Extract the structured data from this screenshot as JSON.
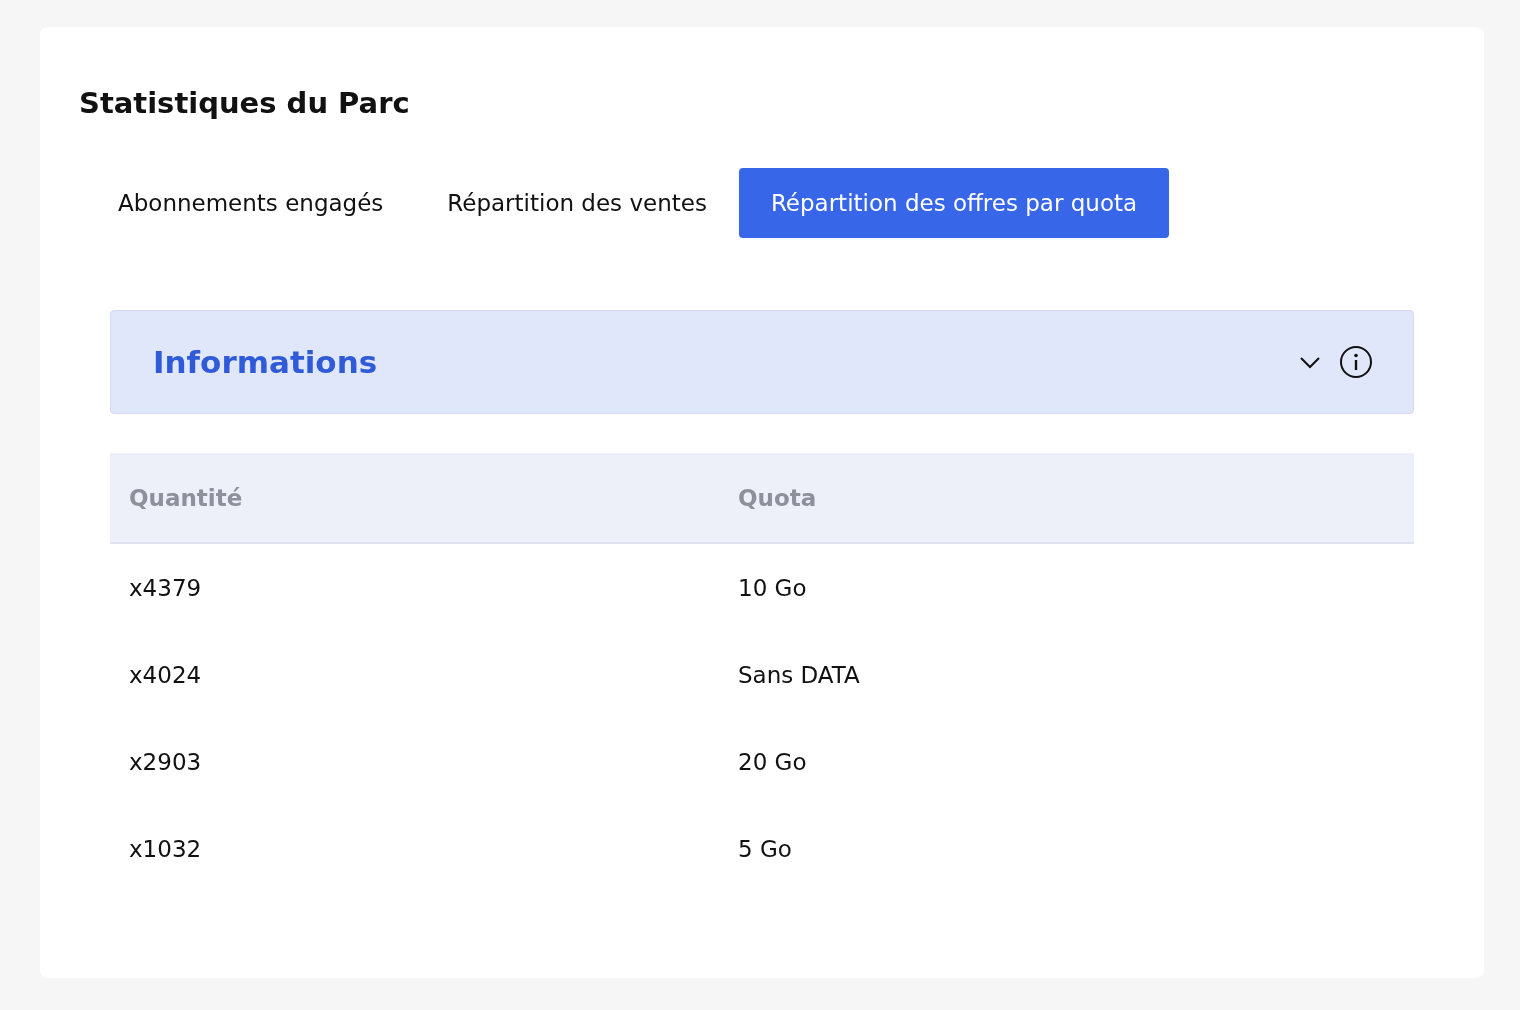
{
  "title": "Statistiques du Parc",
  "tabs": [
    {
      "label": "Abonnements engagés",
      "selected": false
    },
    {
      "label": "Répartition des ventes",
      "selected": false
    },
    {
      "label": "Répartition des offres par quota",
      "selected": true
    }
  ],
  "info_panel": {
    "title": "Informations",
    "expanded": false
  },
  "table": {
    "columns": [
      "Quantité",
      "Quota"
    ],
    "rows": [
      [
        "x4379",
        "10 Go"
      ],
      [
        "x4024",
        "Sans DATA"
      ],
      [
        "x2903",
        "20 Go"
      ],
      [
        "x1032",
        "5 Go"
      ]
    ]
  }
}
